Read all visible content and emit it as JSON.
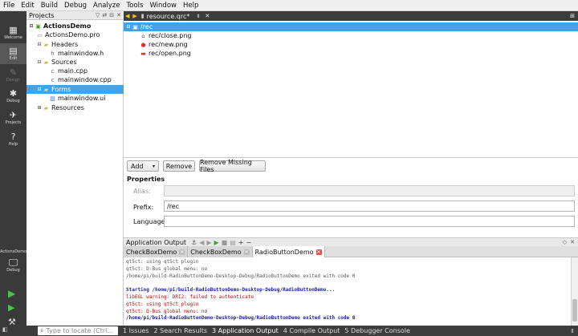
{
  "menu": [
    "File",
    "Edit",
    "Build",
    "Debug",
    "Analyze",
    "Tools",
    "Window",
    "Help"
  ],
  "modes": [
    {
      "label": "Welcome",
      "icon": "grid-icon"
    },
    {
      "label": "Edit",
      "icon": "document-icon"
    },
    {
      "label": "Design",
      "icon": "pencil-icon"
    },
    {
      "label": "Debug",
      "icon": "bug-icon"
    },
    {
      "label": "Projects",
      "icon": "wrench-icon"
    },
    {
      "label": "Help",
      "icon": "help-icon"
    }
  ],
  "kit": {
    "project": "ActionsDemo",
    "label": "Debug"
  },
  "projects": {
    "title": "Projects",
    "tree": [
      {
        "text": "ActionsDemo",
        "kind": "project"
      },
      {
        "text": "ActionsDemo.pro",
        "kind": "pro"
      },
      {
        "text": "Headers",
        "kind": "folder"
      },
      {
        "text": "mainwindow.h",
        "kind": "header"
      },
      {
        "text": "Sources",
        "kind": "folder"
      },
      {
        "text": "main.cpp",
        "kind": "source"
      },
      {
        "text": "mainwindow.cpp",
        "kind": "source"
      },
      {
        "text": "Forms",
        "kind": "folder"
      },
      {
        "text": "mainwindow.ui",
        "kind": "form"
      },
      {
        "text": "Resources",
        "kind": "folder"
      }
    ]
  },
  "editor": {
    "filename": "resource.qrc*"
  },
  "resources": [
    {
      "text": "/rec",
      "kind": "prefix"
    },
    {
      "text": "rec/close.png",
      "kind": "image-close"
    },
    {
      "text": "rec/new.png",
      "kind": "image-new"
    },
    {
      "text": "rec/open.png",
      "kind": "image-open"
    }
  ],
  "buttons": {
    "add": "Add",
    "remove": "Remove",
    "remove_missing": "Remove Missing Files"
  },
  "properties": {
    "title": "Properties",
    "alias_label": "Alias:",
    "alias_value": "",
    "prefix_label": "Prefix:",
    "prefix_value": "/rec",
    "language_label": "Language:",
    "language_value": ""
  },
  "output": {
    "title": "Application Output",
    "tabs": [
      "CheckBoxDemo",
      "CheckBoxDemo",
      "RadioButtonDemo"
    ],
    "lines": [
      {
        "text": "qt5ct: using qt5ct plugin",
        "style": "normal"
      },
      {
        "text": "qt5ct: D-Bus global menu: no",
        "style": "normal"
      },
      {
        "text": "/home/pi/build-RadioButtonDemo-Desktop-Debug/RadioButtonDemo exited with code 0",
        "style": "normal"
      },
      {
        "text": "",
        "style": "normal"
      },
      {
        "text": "Starting /home/pi/build-RadioButtonDemo-Desktop-Debug/RadioButtonDemo...",
        "style": "start"
      },
      {
        "text": "libEGL warning: DRI2: failed to authenticate",
        "style": "error"
      },
      {
        "text": "qt5ct: using qt5ct plugin",
        "style": "error"
      },
      {
        "text": "qt5ct: D-Bus global menu: no",
        "style": "error"
      },
      {
        "text": "/home/pi/build-RadioButtonDemo-Desktop-Debug/RadioButtonDemo exited with code 0",
        "style": "start"
      }
    ]
  },
  "status": {
    "locator_placeholder": "Type to locate (Ctrl...",
    "panes": [
      "1 Issues",
      "2 Search Results",
      "3 Application Output",
      "4 Compile Output",
      "5 Debugger Console"
    ]
  },
  "colors": {
    "selection": "#43a3e6",
    "start_line": "#1a1aa6",
    "error_line": "#c80000",
    "folder": "#d9b44a"
  }
}
